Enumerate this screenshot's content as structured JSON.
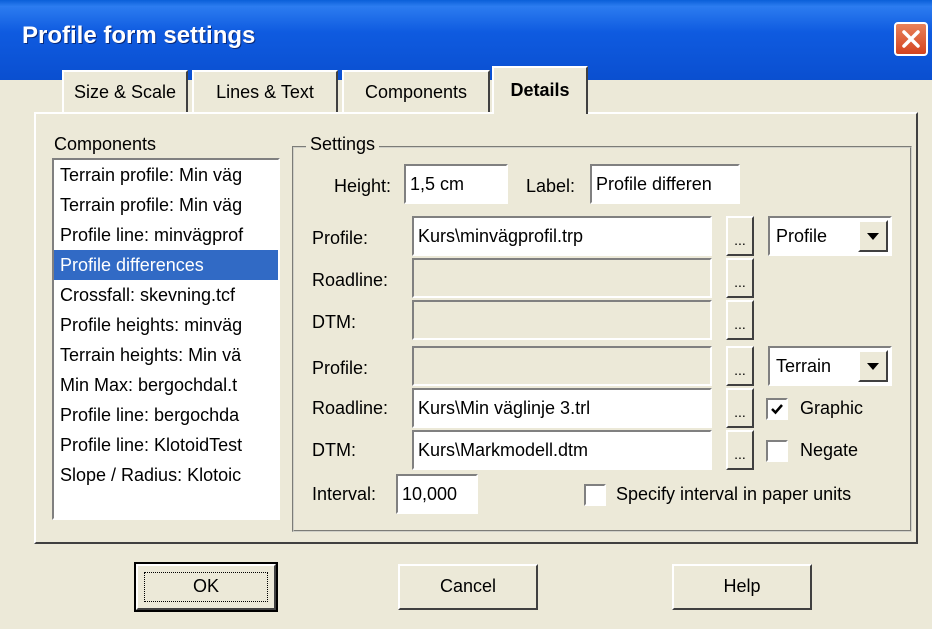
{
  "window": {
    "title": "Profile form settings",
    "close_icon": "close-icon"
  },
  "tabs": [
    {
      "label": "Size & Scale",
      "active": false
    },
    {
      "label": "Lines & Text",
      "active": false
    },
    {
      "label": "Components",
      "active": false
    },
    {
      "label": "Details",
      "active": true
    }
  ],
  "components": {
    "label": "Components",
    "items": [
      "Terrain profile: Min väg",
      "Terrain profile: Min väg",
      "Profile line: minvägprof",
      "Profile differences",
      "Crossfall: skevning.tcf",
      "Profile heights: minväg",
      "Terrain heights: Min vä",
      "Min Max: bergochdal.t",
      "Profile line: bergochda",
      "Profile line: KlotoidTest",
      "Slope / Radius: Klotoic"
    ],
    "selected_index": 3
  },
  "settings": {
    "group_label": "Settings",
    "height_label": "Height:",
    "height_value": "1,5 cm",
    "label_label": "Label:",
    "label_value": "Profile differen",
    "group1": {
      "profile_label": "Profile:",
      "profile_value": "Kurs\\minvägprofil.trp",
      "roadline_label": "Roadline:",
      "roadline_value": "",
      "dtm_label": "DTM:",
      "dtm_value": "",
      "type_value": "Profile"
    },
    "group2": {
      "profile_label": "Profile:",
      "profile_value": "",
      "roadline_label": "Roadline:",
      "roadline_value": "Kurs\\Min väglinje 3.trl",
      "dtm_label": "DTM:",
      "dtm_value": "Kurs\\Markmodell.dtm",
      "type_value": "Terrain",
      "graphic_label": "Graphic",
      "graphic_checked": true,
      "negate_label": "Negate",
      "negate_checked": false
    },
    "browse_label": "...",
    "interval_label": "Interval:",
    "interval_value": "10,000",
    "paper_units_label": "Specify interval in paper units",
    "paper_units_checked": false
  },
  "buttons": {
    "ok": "OK",
    "cancel": "Cancel",
    "help": "Help"
  }
}
